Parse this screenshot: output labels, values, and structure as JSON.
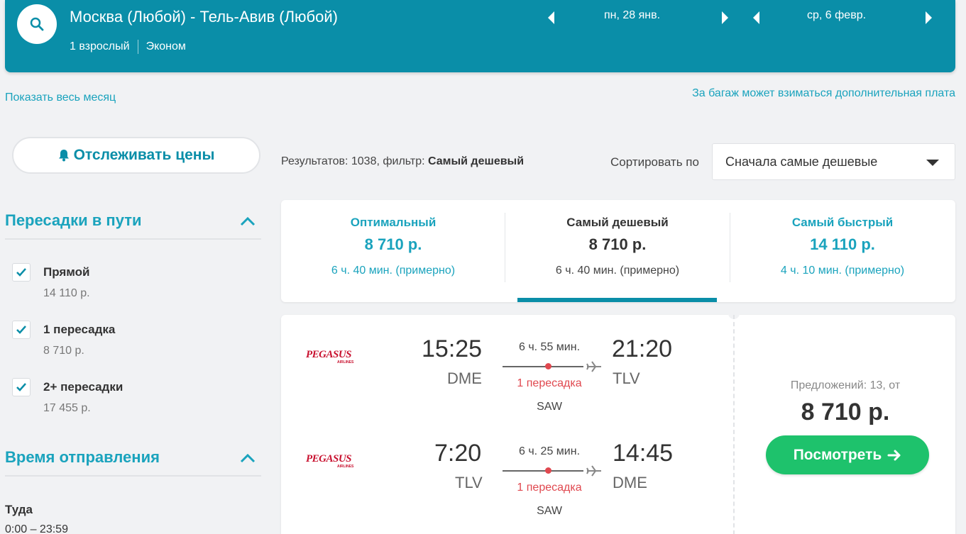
{
  "header": {
    "route": "Москва (Любой) - Тель-Авив (Любой)",
    "passengers": "1 взрослый",
    "cabin": "Эконом",
    "depart_date": "пн, 28 янв.",
    "return_date": "ср, 6 февр.",
    "accent_color": "#0a8ea8"
  },
  "links": {
    "show_month": "Показать весь месяц",
    "baggage_note": "За багаж может взиматься дополнительная плата"
  },
  "track_prices": {
    "label": "Отслеживать цены",
    "icon": "bell-icon"
  },
  "filters": {
    "stops_title": "Пересадки в пути",
    "stops": [
      {
        "label": "Прямой",
        "price": "14 110 р.",
        "checked": true
      },
      {
        "label": "1 пересадка",
        "price": "8 710 р.",
        "checked": true
      },
      {
        "label": "2+ пересадки",
        "price": "17 455 р.",
        "checked": true
      }
    ],
    "departure_title": "Время отправления",
    "direction_label": "Туда",
    "time_range": "0:00 – 23:59"
  },
  "results": {
    "prefix": "Результатов: 1038, фильтр: ",
    "filter": "Самый дешевый"
  },
  "sort": {
    "label": "Сортировать по",
    "selected": "Сначала самые дешевые"
  },
  "tabs": [
    {
      "title": "Оптимальный",
      "price": "8 710 р.",
      "duration": "6 ч. 40 мин. (примерно)",
      "active": false
    },
    {
      "title": "Самый дешевый",
      "price": "8 710 р.",
      "duration": "6 ч. 40 мин. (примерно)",
      "active": true
    },
    {
      "title": "Самый быстрый",
      "price": "14 110 р.",
      "duration": "4 ч. 10 мин. (примерно)",
      "active": false
    }
  ],
  "result_card": {
    "legs": [
      {
        "airline": "PEGASUS",
        "airline_sub": "AIRLINES",
        "dep_time": "15:25",
        "dep_code": "DME",
        "duration": "6 ч. 55 мин.",
        "stops": "1 пересадка",
        "via": "SAW",
        "arr_time": "21:20",
        "arr_code": "TLV"
      },
      {
        "airline": "PEGASUS",
        "airline_sub": "AIRLINES",
        "dep_time": "7:20",
        "dep_code": "TLV",
        "duration": "6 ч. 25 мин.",
        "stops": "1 пересадка",
        "via": "SAW",
        "arr_time": "14:45",
        "arr_code": "DME"
      }
    ],
    "offers_text": "Предложений: 13, от",
    "price": "8 710 р.",
    "view_button": "Посмотреть",
    "button_color": "#1ec26c"
  }
}
